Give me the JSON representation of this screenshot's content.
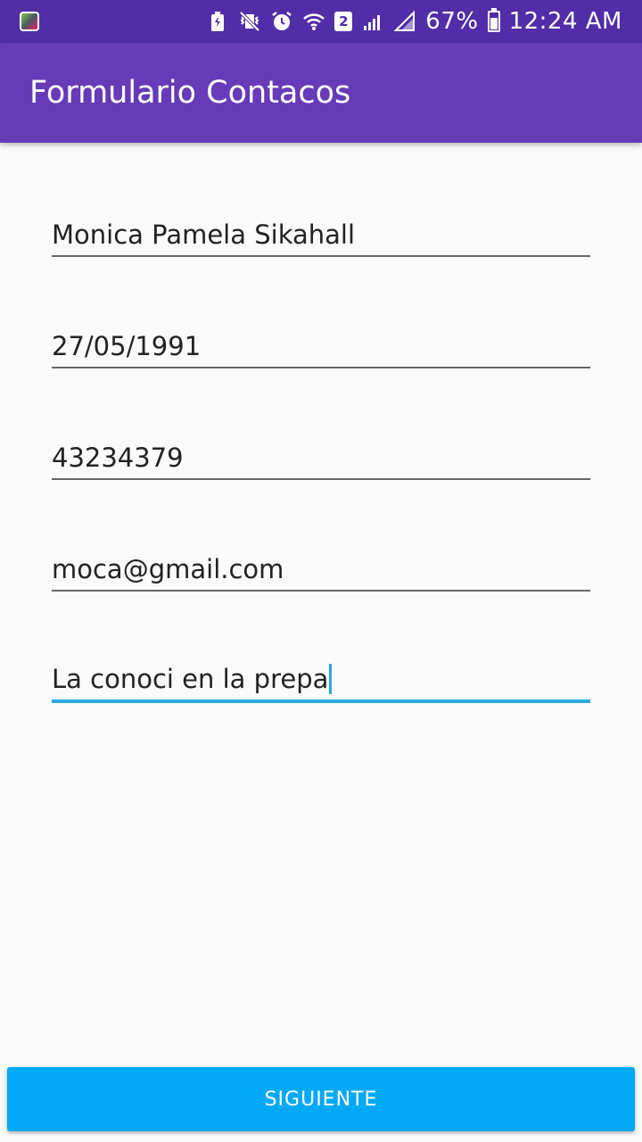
{
  "status_bar": {
    "sim_slot": "2",
    "battery_percent": "67%",
    "battery_level": 0.67,
    "time": "12:24 AM",
    "icons": [
      "app-notification-icon",
      "battery-saver-icon",
      "vibrate-mute-icon",
      "alarm-icon",
      "wifi-icon",
      "signal-icon",
      "no-signal-icon",
      "battery-icon"
    ]
  },
  "app_bar": {
    "title": "Formulario Contacos",
    "color": "#673ab7"
  },
  "form": {
    "name": "Monica Pamela Sikahall",
    "birthdate": "27/05/1991",
    "phone": "43234379",
    "email": "moca@gmail.com",
    "description": "La conoci en la prepa"
  },
  "actions": {
    "next_label": "SIGUIENTE",
    "next_color": "#03a9f4"
  },
  "colors": {
    "status_bar": "#512da8",
    "accent": "#29a8e0"
  }
}
